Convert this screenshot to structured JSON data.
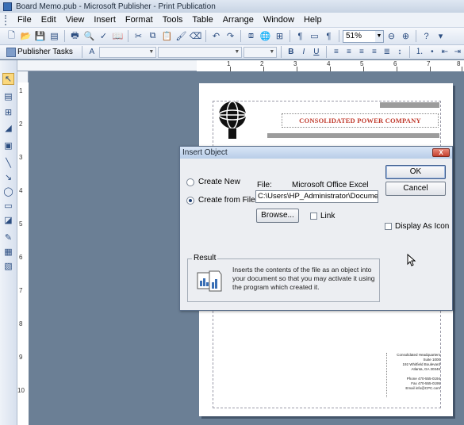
{
  "window": {
    "title": "Board Memo.pub - Microsoft Publisher - Print Publication"
  },
  "menubar": {
    "items": [
      {
        "id": "file",
        "label": "File"
      },
      {
        "id": "edit",
        "label": "Edit"
      },
      {
        "id": "view",
        "label": "View"
      },
      {
        "id": "insert",
        "label": "Insert"
      },
      {
        "id": "format",
        "label": "Format"
      },
      {
        "id": "tools",
        "label": "Tools"
      },
      {
        "id": "table",
        "label": "Table"
      },
      {
        "id": "arrange",
        "label": "Arrange"
      },
      {
        "id": "window",
        "label": "Window"
      },
      {
        "id": "help",
        "label": "Help"
      }
    ]
  },
  "toolbar": {
    "zoom_value": "51%"
  },
  "formatting_toolbar": {
    "publisher_tasks_label": "Publisher Tasks"
  },
  "rulers": {
    "horizontal_labels": [
      "1",
      "2",
      "3",
      "4",
      "5",
      "6",
      "7",
      "8"
    ],
    "vertical_labels": [
      "1",
      "2",
      "3",
      "4",
      "5",
      "6",
      "7",
      "8",
      "9",
      "10"
    ]
  },
  "document": {
    "company_name": "CONSOLIDATED POWER COMPANY",
    "contact_lines": [
      "Consolidated Headquarters",
      "Suite 1000",
      "192 Whitfield Boulevard",
      "Atlanta, GA 30346",
      "",
      "Phone 470-555-0194",
      "Fax 470-555-0195",
      "Email info@CPC.com"
    ]
  },
  "dialog": {
    "title": "Insert Object",
    "close_label": "X",
    "create_new_label": "Create New",
    "create_from_file_label": "Create from File",
    "selected_option": "create_from_file",
    "file_label": "File:",
    "file_type": "Microsoft Office Excel",
    "file_path": "C:\\Users\\HP_Administrator\\Documents\\",
    "browse_label": "Browse...",
    "link_label": "Link",
    "link_checked": false,
    "ok_label": "OK",
    "cancel_label": "Cancel",
    "display_as_icon_label": "Display As Icon",
    "display_as_icon_checked": false,
    "result_label": "Result",
    "result_text": "Inserts the contents of the file as an object into your document so that you may activate it using the program which created it."
  }
}
